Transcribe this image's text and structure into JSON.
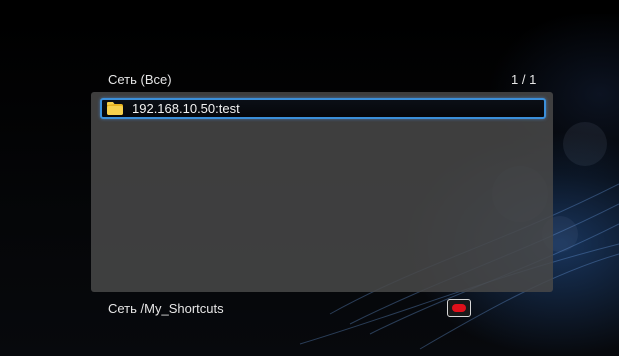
{
  "header": {
    "title": "Сеть (Все)",
    "page_indicator": "1 / 1"
  },
  "list": {
    "items": [
      {
        "label": "192.168.10.50:test",
        "icon": "folder-icon",
        "selected": true
      }
    ]
  },
  "footer": {
    "path": "Сеть /My_Shortcuts",
    "button_icon": "red-button-icon"
  },
  "colors": {
    "selection_border": "#3b8fd9",
    "panel": "#484848",
    "red_button": "#e0101a",
    "folder": "#f3c43a"
  }
}
